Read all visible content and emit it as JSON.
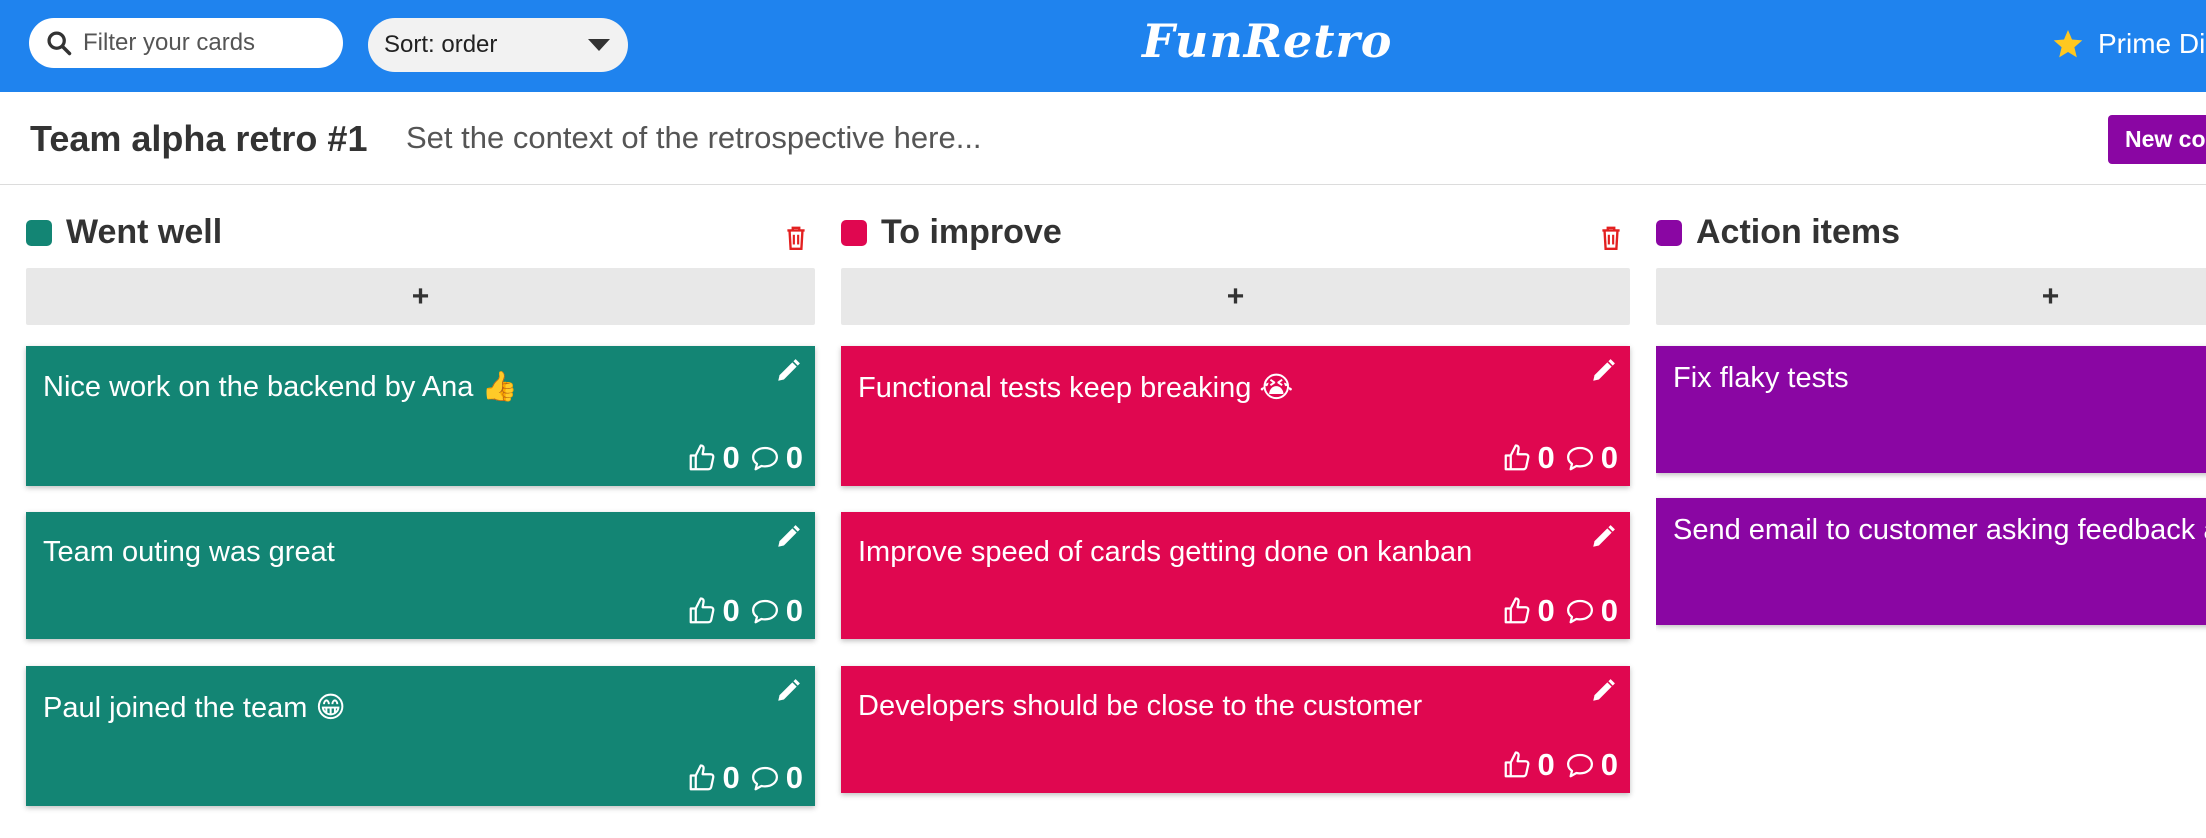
{
  "header": {
    "search_placeholder": "Filter your cards",
    "sort_label": "Sort: order",
    "logo": "FunRetro",
    "user_name": "Prime Dir",
    "color": "#1f83ee"
  },
  "board": {
    "title": "Team alpha retro #1",
    "context": "Set the context of the retrospective here...",
    "new_column_button": "New colu"
  },
  "columns": [
    {
      "title": "Went well",
      "color": "#138574",
      "add_label": "+",
      "cards": [
        {
          "text": "Nice work on the backend by Ana 👍",
          "likes": "0",
          "comments": "0"
        },
        {
          "text": "Team outing was great",
          "likes": "0",
          "comments": "0"
        },
        {
          "text": "Paul joined the team 😁",
          "likes": "0",
          "comments": "0"
        }
      ]
    },
    {
      "title": "To improve",
      "color": "#e00750",
      "add_label": "+",
      "cards": [
        {
          "text": "Functional tests keep breaking 😭",
          "likes": "0",
          "comments": "0"
        },
        {
          "text": "Improve speed of cards getting done on kanban",
          "likes": "0",
          "comments": "0"
        },
        {
          "text": "Developers should be close to the customer",
          "likes": "0",
          "comments": "0"
        }
      ]
    },
    {
      "title": "Action items",
      "color": "#8a06a3",
      "add_label": "+",
      "cards": [
        {
          "text": "Fix flaky tests"
        },
        {
          "text": "Send email to customer asking feedback ab"
        }
      ]
    }
  ]
}
